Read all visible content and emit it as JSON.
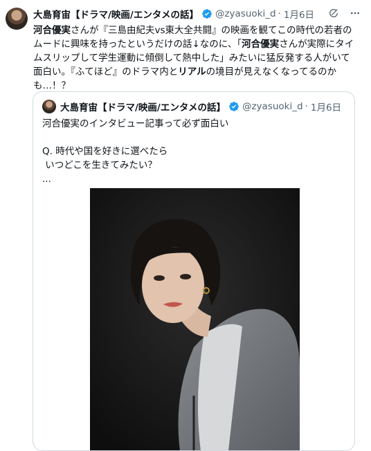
{
  "tweet": {
    "display_name": "大島育宙【ドラマ/映画/エンタメの話】",
    "handle": "@zyasuoki_d",
    "separator": "·",
    "date": "1月6日",
    "body": {
      "p1": "河合優実",
      "p2": "さんが『三島由紀夫vs東大全共闘』の映画を観てこの時代の若者のムードに興味を持ったというだけの話↓なのに、「",
      "p3": "河合優実",
      "p4": "さんが実際にタイムスリップして学生運動に傾倒して熱中した」みたいに猛反発する人がいて面白い。『ふてほど』のドラマ内と",
      "p5": "リアル",
      "p6": "の境目が見えなくなってるのかも…！？"
    }
  },
  "quote": {
    "display_name": "大島育宙【ドラマ/映画/エンタメの話】",
    "handle": "@zyasuoki_d",
    "separator": "·",
    "date": "1月6日",
    "lines": [
      "河合優実のインタビュー記事って必ず面白い",
      "",
      "Q. 時代や国を好きに選べたら",
      " いつどこを生きてみたい？",
      "..."
    ]
  },
  "colors": {
    "verified": "#1d9bf0",
    "secondary_text": "#536471",
    "border": "#cfd9de"
  },
  "icons": {
    "verified": "verified-badge-icon",
    "grok": "grok-icon",
    "more": "more-options-icon"
  }
}
